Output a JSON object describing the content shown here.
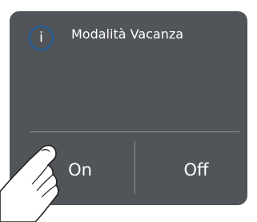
{
  "dialog": {
    "title": "Modalità Vacanza",
    "info_glyph": "i",
    "info_icon": "info-icon",
    "on_label": "On",
    "off_label": "Off"
  },
  "colors": {
    "panel": "#515458",
    "icon_ring": "#1f5f9e",
    "text": "#ffffff",
    "divider": "#8d9094"
  },
  "hand": {
    "icon": "pointing-finger-icon"
  }
}
